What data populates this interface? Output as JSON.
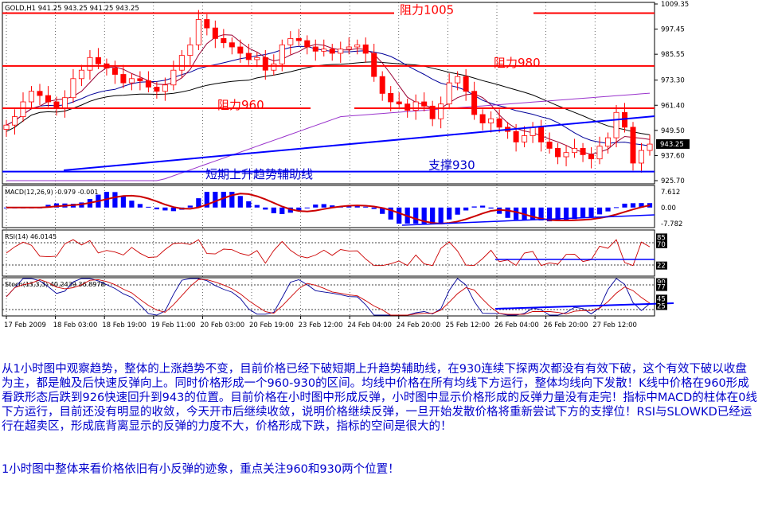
{
  "chart_data": {
    "type": "line",
    "main": {
      "header": "GOLD,H1  941.25 943.25 941.25 943.25",
      "y_ticks": [
        "1009.35",
        "997.45",
        "985.55",
        "973.30",
        "961.40",
        "949.50",
        "937.60",
        "925.70"
      ],
      "last_price": "943.25",
      "price_values": [
        952,
        956,
        963,
        968,
        966,
        963,
        960,
        965,
        974,
        978,
        984,
        981,
        979,
        976,
        972,
        974,
        973,
        970,
        968,
        971,
        978,
        985,
        990,
        1002,
        998,
        993,
        991,
        989,
        986,
        983,
        984,
        978,
        981,
        990,
        993,
        992,
        989,
        987,
        988,
        986,
        988,
        989,
        990,
        986,
        975,
        967,
        963,
        962,
        959,
        963,
        961,
        955,
        962,
        972,
        975,
        968,
        957,
        953,
        955,
        951,
        949,
        944,
        947,
        951,
        944,
        941,
        937,
        939,
        941,
        938,
        936,
        942,
        946,
        958,
        951,
        934,
        940,
        943
      ],
      "levels": [
        {
          "label": "阻力1005",
          "value": 1005
        },
        {
          "label": "阻力980",
          "value": 980
        },
        {
          "label": "阻力960",
          "value": 960
        },
        {
          "label": "支撑930",
          "value": 930
        }
      ],
      "trend_label": "短期上升趋势辅助线"
    },
    "macd": {
      "header": "MACD(12,26,9) -0.979 -0.001",
      "y_ticks": [
        "7.612",
        "0.00",
        "-7.782"
      ]
    },
    "rsi": {
      "header": "RSI(14) 46.0145",
      "y_ticks": [
        "85",
        "70",
        "22"
      ]
    },
    "stoch": {
      "header": "Stoch(13,3,3) 40.2439 36.8978",
      "y_ticks": [
        "90",
        "77",
        "45",
        "25"
      ]
    },
    "x_ticks": [
      "17 Feb 2009",
      "18 Feb 03:00",
      "18 Feb 19:00",
      "19 Feb 11:00",
      "20 Feb 03:00",
      "20 Feb 19:00",
      "23 Feb 12:00",
      "24 Feb 04:00",
      "24 Feb 20:00",
      "25 Feb 12:00",
      "26 Feb 04:00",
      "26 Feb 20:00",
      "27 Feb 12:00"
    ]
  },
  "commentary": {
    "p1": "从1小时图中观察趋势，整体的上涨趋势不变，目前价格已经下破短期上升趋势辅助线，在930连续下探两次都没有有效下破，这个有效下破以收盘为主，都是触及后快速反弹向上。同时价格形成一个960-930的区间。均线中价格在所有均线下方运行，整体均线向下发散！K线中价格在960形成看跌形态后跌到926快速回升到943的位置。目前价格在小时图中形成反弹，小时图中显示价格形成的反弹力量没有走完！指标中MACD的柱体在0线下方运行，目前还没有明显的收敛，今天开市后继续收敛，说明价格继续反弹，一旦开始发散价格将重新尝试下方的支撑位！RSI与SLOWKD已经运行在超卖区，形成底背离显示的反弹的力度不大，价格形成下跌，指标的空间是很大的！",
    "p2": "1小时图中整体来看价格依旧有小反弹的迹象，重点关注960和930两个位置！"
  },
  "colors": {
    "level": "#ff0000",
    "blue": "#0000ff",
    "price": "#ff0000",
    "ma_black": "#000000",
    "ma_navy": "#000099",
    "ma_purple": "#9933cc",
    "ma_maroon": "#990033"
  }
}
